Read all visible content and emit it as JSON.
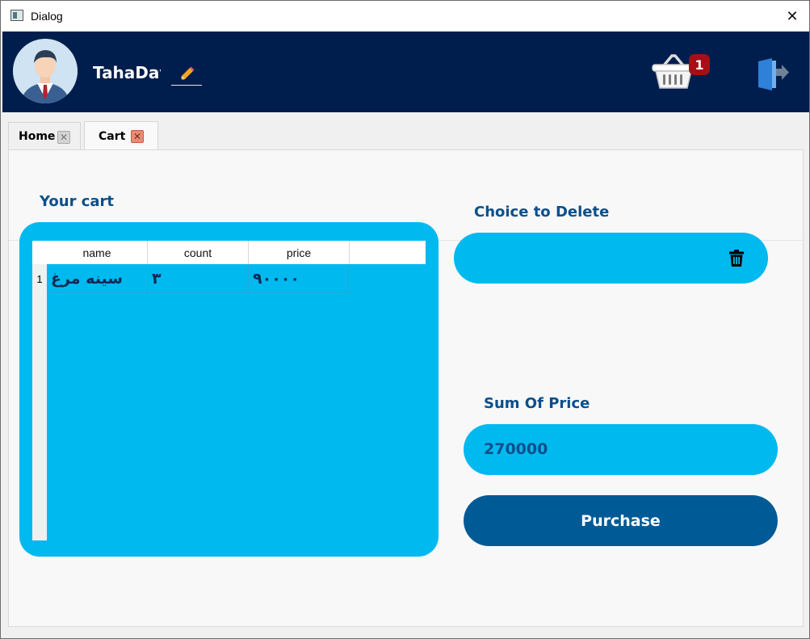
{
  "window": {
    "title": "Dialog",
    "close_glyph": "✕"
  },
  "header": {
    "username": "TahaDavari",
    "avatar_icon": "user-avatar-icon",
    "edit_icon": "pencil-icon",
    "cart_icon": "basket-icon",
    "cart_badge": "1",
    "logout_icon": "logout-door-icon",
    "colors": {
      "background": "#001e4d",
      "badge": "#a50f17"
    }
  },
  "tabs": [
    {
      "label": "Home",
      "close_glyph": "✕",
      "active": false
    },
    {
      "label": "Cart",
      "close_glyph": "✕",
      "active": true
    }
  ],
  "cart": {
    "title": "Your cart",
    "table": {
      "columns": [
        "name",
        "count",
        "price"
      ],
      "rows": [
        {
          "index": "1",
          "cells": [
            "سینه مرغ",
            "۳",
            "۹۰۰۰۰"
          ]
        }
      ]
    }
  },
  "delete": {
    "title": "Choice to Delete",
    "value": "",
    "icon": "trash-icon"
  },
  "sum": {
    "title": "Sum Of Price",
    "value": "270000"
  },
  "purchase": {
    "label": "Purchase"
  },
  "colors": {
    "accent": "#00b9ef",
    "label_text": "#0a4f8b",
    "purchase_button": "#005a96"
  }
}
